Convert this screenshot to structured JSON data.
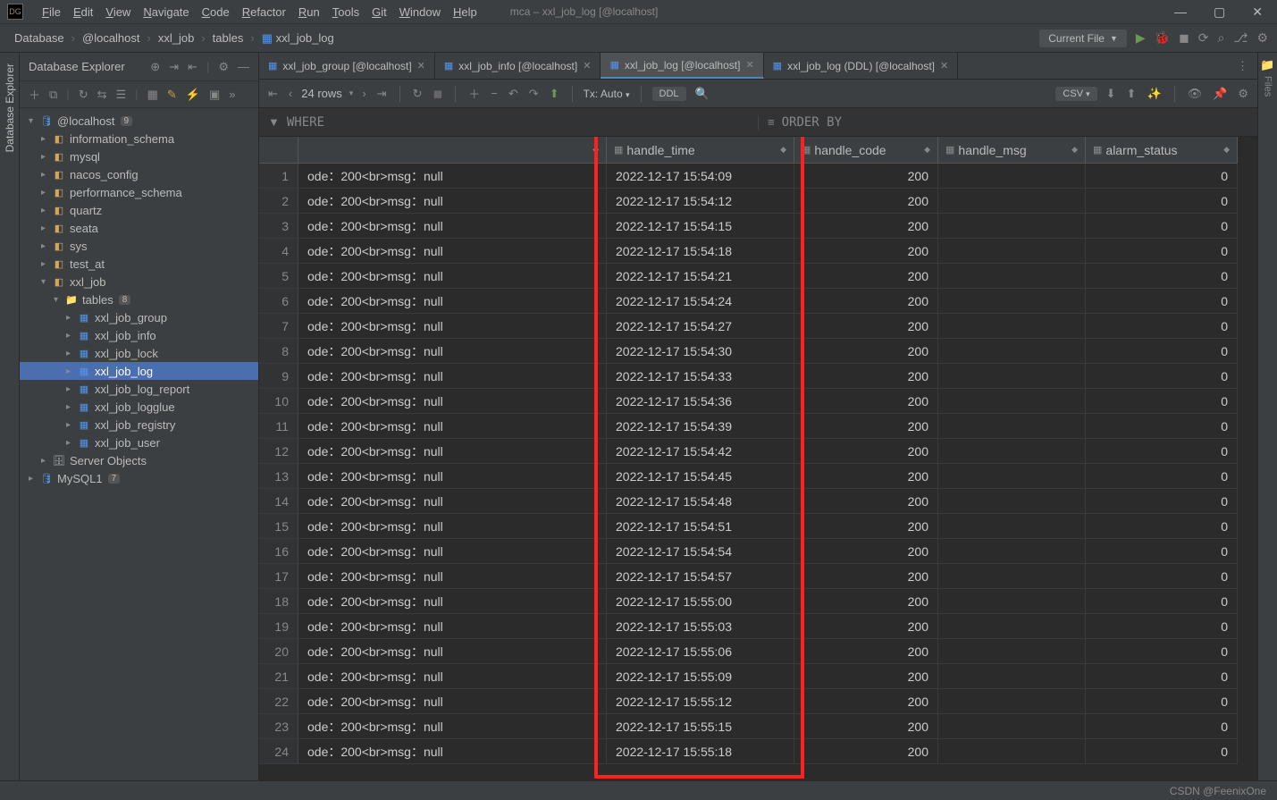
{
  "window": {
    "title": "mca – xxl_job_log [@localhost]",
    "logo": "DG"
  },
  "menus": [
    "File",
    "Edit",
    "View",
    "Navigate",
    "Code",
    "Refactor",
    "Run",
    "Tools",
    "Git",
    "Window",
    "Help"
  ],
  "breadcrumbs": [
    "Database",
    "@localhost",
    "xxl_job",
    "tables",
    "xxl_job_log"
  ],
  "current_file_label": "Current File",
  "explorer": {
    "title": "Database Explorer",
    "root": {
      "name": "@localhost",
      "badge": "9"
    },
    "schemas": [
      "information_schema",
      "mysql",
      "nacos_config",
      "performance_schema",
      "quartz",
      "seata",
      "sys",
      "test_at"
    ],
    "active_schema": "xxl_job",
    "tables_label": "tables",
    "tables_badge": "8",
    "tables": [
      "xxl_job_group",
      "xxl_job_info",
      "xxl_job_lock",
      "xxl_job_log",
      "xxl_job_log_report",
      "xxl_job_logglue",
      "xxl_job_registry",
      "xxl_job_user"
    ],
    "selected_table": "xxl_job_log",
    "server_objects": "Server Objects",
    "second_conn": {
      "name": "MySQL1",
      "badge": "7"
    },
    "sidebar_tab": "Database Explorer"
  },
  "editor_tabs": [
    {
      "label": "xxl_job_group [@localhost]",
      "active": false
    },
    {
      "label": "xxl_job_info [@localhost]",
      "active": false
    },
    {
      "label": "xxl_job_log [@localhost]",
      "active": true
    },
    {
      "label": "xxl_job_log (DDL) [@localhost]",
      "active": false
    }
  ],
  "data_toolbar": {
    "row_count": "24 rows",
    "tx": "Tx: Auto",
    "ddl": "DDL",
    "csv": "CSV"
  },
  "filter": {
    "where": "WHERE",
    "order": "ORDER BY"
  },
  "columns": [
    "",
    "handle_time",
    "handle_code",
    "handle_msg",
    "alarm_status"
  ],
  "rows": [
    {
      "n": 1,
      "msg": "ode：200<br>msg：null",
      "time": "2022-12-17 15:54:09",
      "code": "200",
      "hmsg": "",
      "alarm": "0"
    },
    {
      "n": 2,
      "msg": "ode：200<br>msg：null",
      "time": "2022-12-17 15:54:12",
      "code": "200",
      "hmsg": "",
      "alarm": "0"
    },
    {
      "n": 3,
      "msg": "ode：200<br>msg：null",
      "time": "2022-12-17 15:54:15",
      "code": "200",
      "hmsg": "",
      "alarm": "0"
    },
    {
      "n": 4,
      "msg": "ode：200<br>msg：null",
      "time": "2022-12-17 15:54:18",
      "code": "200",
      "hmsg": "",
      "alarm": "0"
    },
    {
      "n": 5,
      "msg": "ode：200<br>msg：null",
      "time": "2022-12-17 15:54:21",
      "code": "200",
      "hmsg": "",
      "alarm": "0"
    },
    {
      "n": 6,
      "msg": "ode：200<br>msg：null",
      "time": "2022-12-17 15:54:24",
      "code": "200",
      "hmsg": "",
      "alarm": "0"
    },
    {
      "n": 7,
      "msg": "ode：200<br>msg：null",
      "time": "2022-12-17 15:54:27",
      "code": "200",
      "hmsg": "",
      "alarm": "0"
    },
    {
      "n": 8,
      "msg": "ode：200<br>msg：null",
      "time": "2022-12-17 15:54:30",
      "code": "200",
      "hmsg": "",
      "alarm": "0"
    },
    {
      "n": 9,
      "msg": "ode：200<br>msg：null",
      "time": "2022-12-17 15:54:33",
      "code": "200",
      "hmsg": "",
      "alarm": "0"
    },
    {
      "n": 10,
      "msg": "ode：200<br>msg：null",
      "time": "2022-12-17 15:54:36",
      "code": "200",
      "hmsg": "",
      "alarm": "0"
    },
    {
      "n": 11,
      "msg": "ode：200<br>msg：null",
      "time": "2022-12-17 15:54:39",
      "code": "200",
      "hmsg": "",
      "alarm": "0"
    },
    {
      "n": 12,
      "msg": "ode：200<br>msg：null",
      "time": "2022-12-17 15:54:42",
      "code": "200",
      "hmsg": "",
      "alarm": "0"
    },
    {
      "n": 13,
      "msg": "ode：200<br>msg：null",
      "time": "2022-12-17 15:54:45",
      "code": "200",
      "hmsg": "",
      "alarm": "0"
    },
    {
      "n": 14,
      "msg": "ode：200<br>msg：null",
      "time": "2022-12-17 15:54:48",
      "code": "200",
      "hmsg": "",
      "alarm": "0"
    },
    {
      "n": 15,
      "msg": "ode：200<br>msg：null",
      "time": "2022-12-17 15:54:51",
      "code": "200",
      "hmsg": "",
      "alarm": "0"
    },
    {
      "n": 16,
      "msg": "ode：200<br>msg：null",
      "time": "2022-12-17 15:54:54",
      "code": "200",
      "hmsg": "",
      "alarm": "0"
    },
    {
      "n": 17,
      "msg": "ode：200<br>msg：null",
      "time": "2022-12-17 15:54:57",
      "code": "200",
      "hmsg": "",
      "alarm": "0"
    },
    {
      "n": 18,
      "msg": "ode：200<br>msg：null",
      "time": "2022-12-17 15:55:00",
      "code": "200",
      "hmsg": "",
      "alarm": "0"
    },
    {
      "n": 19,
      "msg": "ode：200<br>msg：null",
      "time": "2022-12-17 15:55:03",
      "code": "200",
      "hmsg": "",
      "alarm": "0"
    },
    {
      "n": 20,
      "msg": "ode：200<br>msg：null",
      "time": "2022-12-17 15:55:06",
      "code": "200",
      "hmsg": "",
      "alarm": "0"
    },
    {
      "n": 21,
      "msg": "ode：200<br>msg：null",
      "time": "2022-12-17 15:55:09",
      "code": "200",
      "hmsg": "",
      "alarm": "0"
    },
    {
      "n": 22,
      "msg": "ode：200<br>msg：null",
      "time": "2022-12-17 15:55:12",
      "code": "200",
      "hmsg": "",
      "alarm": "0"
    },
    {
      "n": 23,
      "msg": "ode：200<br>msg：null",
      "time": "2022-12-17 15:55:15",
      "code": "200",
      "hmsg": "",
      "alarm": "0"
    },
    {
      "n": 24,
      "msg": "ode：200<br>msg：null",
      "time": "2022-12-17 15:55:18",
      "code": "200",
      "hmsg": "",
      "alarm": "0"
    }
  ],
  "footer": {
    "watermark": "CSDN @FeenixOne"
  },
  "right_edge_label": "Files"
}
